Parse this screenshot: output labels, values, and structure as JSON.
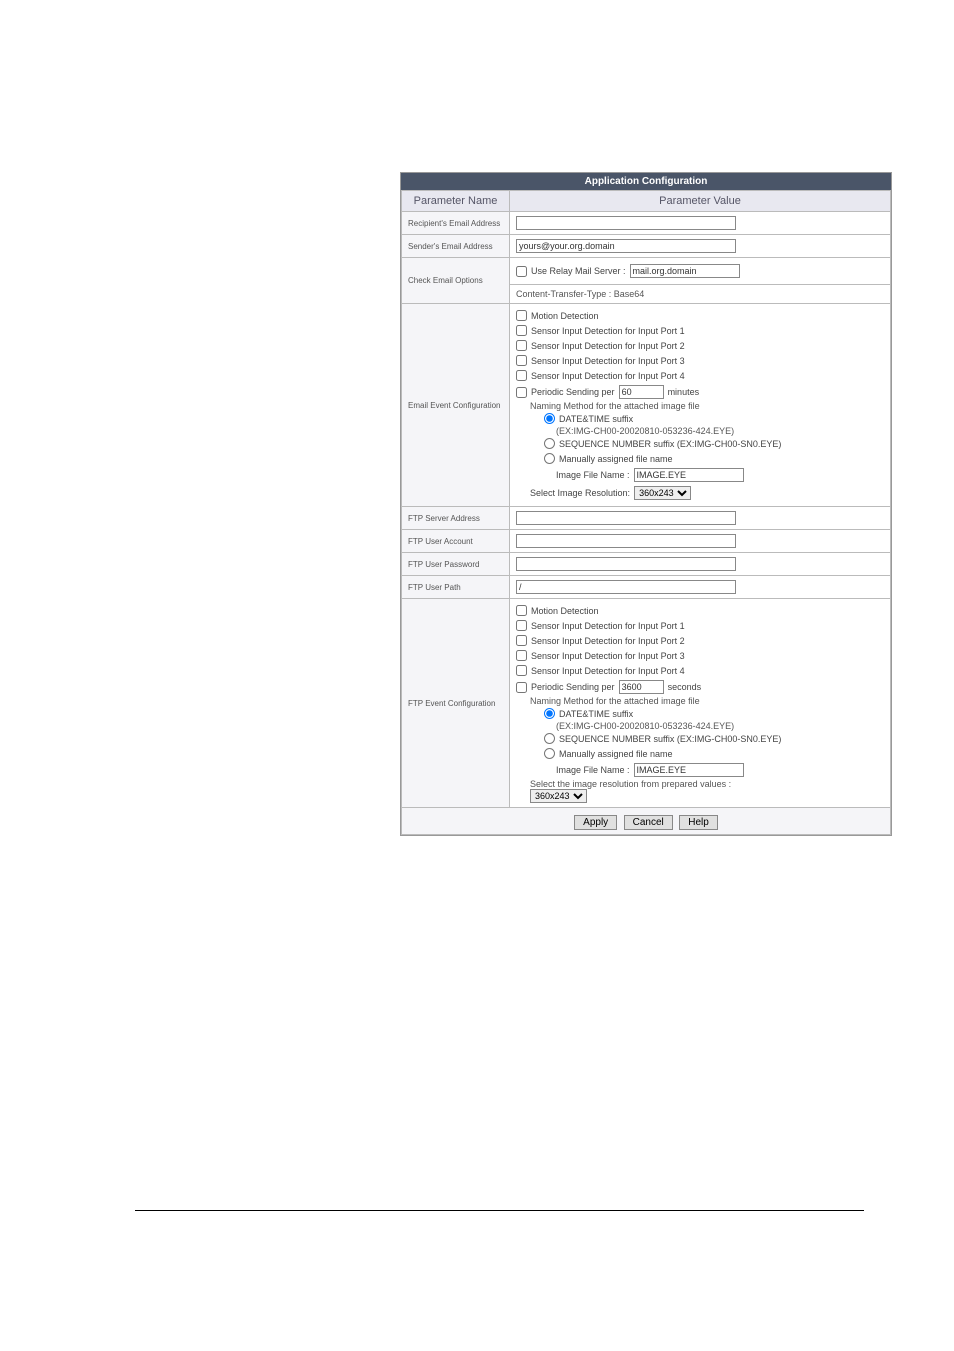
{
  "title": "Application Configuration",
  "headers": {
    "name": "Parameter Name",
    "value": "Parameter Value"
  },
  "rows": {
    "recip_label": "Recipient's Email Address",
    "sender_label": "Sender's Email Address",
    "sender_value": "yours@your.org.domain",
    "chk_email_label": "Check Email Options",
    "relay_label": "Use Relay Mail Server :",
    "relay_value": "mail.org.domain",
    "content_type": "Content-Transfer-Type :  Base64",
    "email_event_label": "Email Event Configuration",
    "motion": "Motion Detection",
    "sensor1": "Sensor Input Detection for Input Port 1",
    "sensor2": "Sensor Input Detection for Input Port 2",
    "sensor3": "Sensor Input Detection for Input Port 3",
    "sensor4": "Sensor Input Detection for Input Port 4",
    "periodic_min": "Periodic Sending per",
    "periodic_min_val": "60",
    "periodic_min_unit": "minutes",
    "naming": "Naming Method for the attached image file",
    "datetime": "DATE&TIME suffix",
    "datetime_ex": "(EX:IMG-CH00-20020810-053236-424.EYE)",
    "seqnum": "SEQUENCE NUMBER suffix (EX:IMG-CH00-SN0.EYE)",
    "manual": "Manually assigned file name",
    "imgfilename_lbl": "Image File Name :",
    "imgfilename_val": "IMAGE.EYE",
    "selres": "Select Image Resolution:",
    "res_val": "360x243",
    "ftp_addr_label": "FTP Server Address",
    "ftp_acct_label": "FTP User Account",
    "ftp_pass_label": "FTP User Password",
    "ftp_path_label": "FTP User Path",
    "ftp_path_val": "/",
    "ftp_event_label": "FTP Event Configuration",
    "periodic_sec_val": "3600",
    "periodic_sec_unit": "seconds",
    "selres2": "Select the image resolution from prepared values :"
  },
  "buttons": {
    "apply": "Apply",
    "cancel": "Cancel",
    "help": "Help"
  }
}
